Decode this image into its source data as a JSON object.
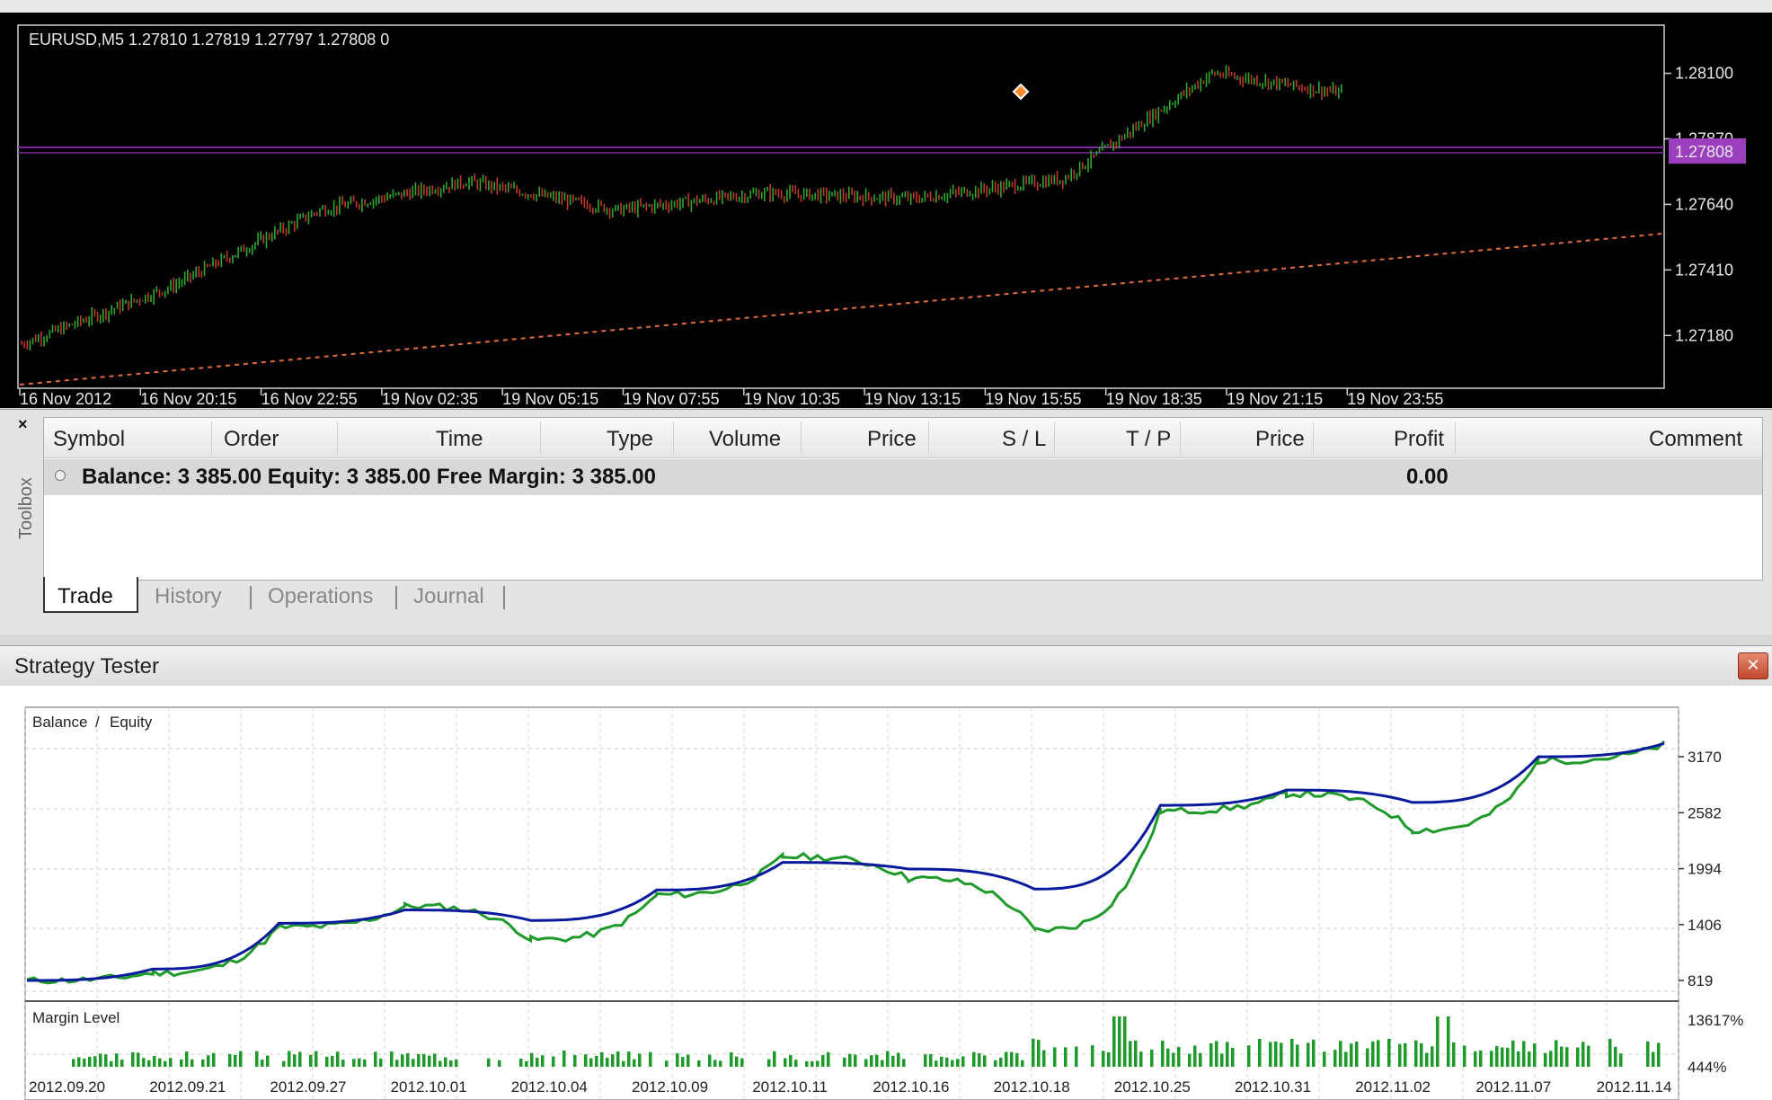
{
  "price_chart": {
    "header_text": "EURUSD,M5  1.27810 1.27819 1.27797 1.27808  0",
    "price_labels": [
      "1.28100",
      "1.27870",
      "1.27640",
      "1.27410",
      "1.27180"
    ],
    "current_price": "1.27808",
    "time_labels": [
      "16 Nov 2012",
      "16 Nov 20:15",
      "16 Nov 22:55",
      "19 Nov 02:35",
      "19 Nov 05:15",
      "19 Nov 07:55",
      "19 Nov 10:35",
      "19 Nov 13:15",
      "19 Nov 15:55",
      "19 Nov 18:35",
      "19 Nov 21:15",
      "19 Nov 23:55"
    ],
    "colors": {
      "background": "#000000",
      "bull": "#2ea82e",
      "bear": "#c0392b",
      "level_line": "#7a2c9c",
      "trend_line": "#e06a3a",
      "price_tag": "#9b3fbf"
    }
  },
  "toolbox": {
    "close_symbol": "×",
    "side_label": "Toolbox",
    "columns": [
      "Symbol",
      "Order",
      "Time",
      "Type",
      "Volume",
      "Price",
      "S / L",
      "T / P",
      "Price",
      "Profit",
      "Comment"
    ],
    "balance_text": "Balance: 3 385.00  Equity: 3 385.00  Free Margin: 3 385.00",
    "profit": "0.00",
    "tabs": [
      "Trade",
      "History",
      "Operations",
      "Journal"
    ],
    "active_tab": "Trade"
  },
  "strategy_tester": {
    "title": "Strategy Tester",
    "close_icon": "close-icon",
    "legend_balance": "Balance",
    "legend_sep": " / ",
    "legend_equity": "Equity",
    "margin_label": "Margin Level",
    "y_labels": [
      "3170",
      "2582",
      "1994",
      "1406",
      "819"
    ],
    "margin_labels": [
      "13617%",
      "444%"
    ],
    "x_labels": [
      "2012.09.20",
      "2012.09.21",
      "2012.09.27",
      "2012.10.01",
      "2012.10.04",
      "2012.10.09",
      "2012.10.11",
      "2012.10.16",
      "2012.10.18",
      "2012.10.25",
      "2012.10.31",
      "2012.11.02",
      "2012.11.07",
      "2012.11.14"
    ],
    "colors": {
      "balance": "#0a1a9c",
      "equity": "#1e9a2a",
      "margin_bars": "#1e9a2a"
    }
  },
  "chart_data": [
    {
      "type": "line",
      "title": "EURUSD,M5",
      "x": [
        "16 Nov 2012",
        "16 Nov 20:15",
        "16 Nov 22:55",
        "19 Nov 02:35",
        "19 Nov 05:15",
        "19 Nov 07:55",
        "19 Nov 10:35",
        "19 Nov 13:15",
        "19 Nov 15:55",
        "19 Nov 18:35",
        "19 Nov 21:15",
        "19 Nov 23:55"
      ],
      "series": [
        {
          "values": [
            1.2715,
            1.2735,
            1.2762,
            1.2772,
            1.2762,
            1.2768,
            1.2766,
            1.2773,
            1.281,
            1.2802,
            1.2806,
            1.278
          ]
        }
      ],
      "xlabel": "",
      "ylabel": "",
      "ylim": [
        1.2702,
        1.2825
      ]
    },
    {
      "type": "line",
      "x": [
        "2012.09.20",
        "2012.09.21",
        "2012.09.27",
        "2012.10.01",
        "2012.10.04",
        "2012.10.09",
        "2012.10.11",
        "2012.10.16",
        "2012.10.18",
        "2012.10.25",
        "2012.10.31",
        "2012.11.02",
        "2012.11.07",
        "2012.11.14"
      ],
      "series": [
        {
          "name": "Balance",
          "values": [
            819,
            940,
            1420,
            1560,
            1450,
            1770,
            2060,
            1990,
            1780,
            2660,
            2820,
            2690,
            3170,
            3310
          ]
        },
        {
          "name": "Equity",
          "values": [
            819,
            900,
            1380,
            1600,
            1250,
            1720,
            2120,
            1890,
            1350,
            2600,
            2780,
            2400,
            3130,
            3300
          ]
        }
      ],
      "xlabel": "",
      "ylabel": "",
      "ylim": [
        819,
        3350
      ]
    }
  ]
}
